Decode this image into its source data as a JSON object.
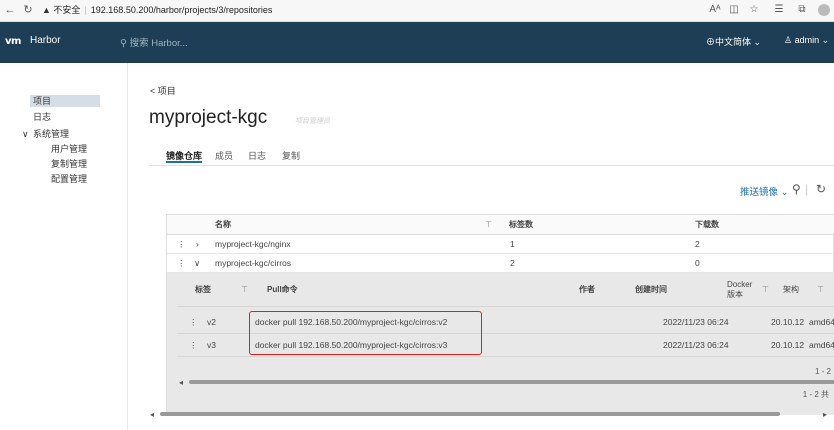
{
  "browser": {
    "security_label": "不安全",
    "url": "192.168.50.200/harbor/projects/3/repositories",
    "reader_icon": "Aᴬ"
  },
  "header": {
    "brand": "Harbor",
    "logo": "vm",
    "search_placeholder": "搜索 Harbor...",
    "language": "中文简体",
    "user": "admin"
  },
  "sidebar": {
    "items": [
      "项目",
      "日志",
      "系统管理",
      "用户管理",
      "复制管理",
      "配置管理"
    ]
  },
  "page": {
    "back_label": "项目",
    "title": "myproject-kgc",
    "role": "项目管理员",
    "tabs": [
      "镜像仓库",
      "成员",
      "日志",
      "复制"
    ],
    "push_label": "推送镜像"
  },
  "table": {
    "columns": [
      "名称",
      "标签数",
      "下载数"
    ],
    "rows": [
      {
        "name": "myproject-kgc/nginx",
        "tags": "1",
        "pulls": "2"
      },
      {
        "name": "myproject-kgc/cirros",
        "tags": "2",
        "pulls": "0"
      }
    ],
    "footer": "1 - 2 共"
  },
  "inner_table": {
    "columns": [
      "标签",
      "Pull命令",
      "作者",
      "创建时间",
      "Docker",
      "版本",
      "架构"
    ],
    "rows": [
      {
        "tag": "v2",
        "pull": "docker pull 192.168.50.200/myproject-kgc/cirros:v2",
        "created": "2022/11/23 06:24",
        "docker": "20.10.12",
        "arch": "amd64"
      },
      {
        "tag": "v3",
        "pull": "docker pull 192.168.50.200/myproject-kgc/cirros:v3",
        "created": "2022/11/23 06:24",
        "docker": "20.10.12",
        "arch": "amd64"
      }
    ],
    "footer": "1 - 2"
  },
  "colors": {
    "header_bg": "#1d3e55",
    "accent": "#1d6ea8",
    "highlight": "#e02020"
  }
}
